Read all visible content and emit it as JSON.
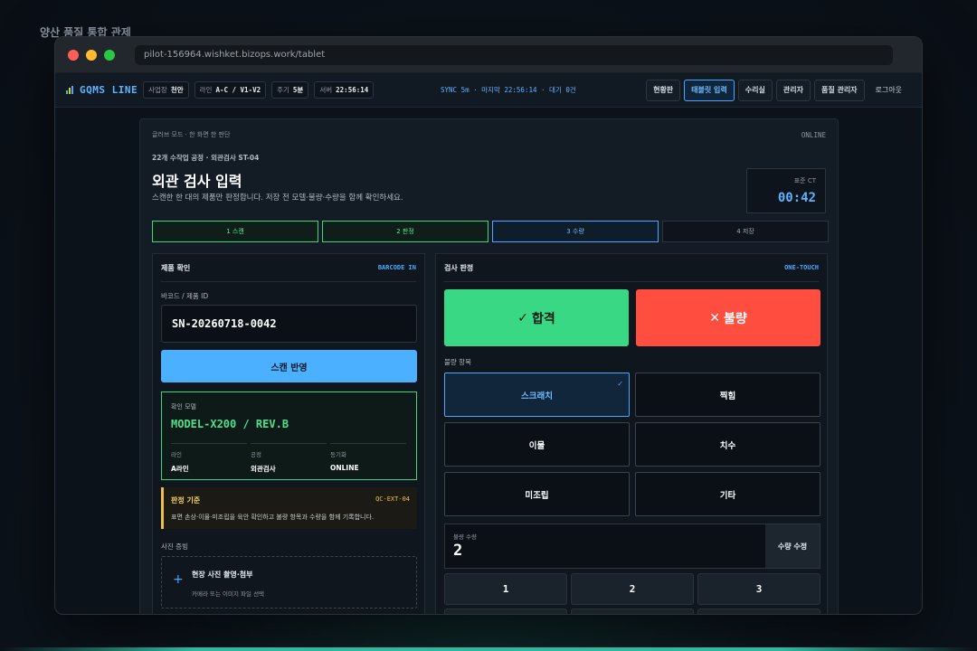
{
  "page_caption": "양산 품질 통합 관제",
  "browser": {
    "url": "pilot-156964.wishket.bizops.work/tablet"
  },
  "appbar": {
    "brand": "GQMS LINE",
    "chips": [
      {
        "label": "사업장",
        "value": "천안"
      },
      {
        "label": "라인",
        "value": "A-C / V1-V2"
      },
      {
        "label": "주기",
        "value": "5분"
      },
      {
        "label": "서버",
        "value": "22:56:14"
      }
    ],
    "sync": "SYNC 5m · 마지막 22:56:14 · 대기 0건",
    "nav": [
      {
        "label": "현황판",
        "state": "normal"
      },
      {
        "label": "태블릿 입력",
        "state": "active"
      },
      {
        "label": "수리실",
        "state": "normal"
      },
      {
        "label": "관리자",
        "state": "normal"
      },
      {
        "label": "품질 관리자",
        "state": "normal"
      },
      {
        "label": "로그아웃",
        "state": "plain"
      }
    ]
  },
  "panel": {
    "mode": "글러브 모드 · 한 화면 한 판단",
    "status": "ONLINE",
    "crumb": "22개 수작업 공정 · 외관검사 ST-04",
    "title": "외관 검사 입력",
    "subtitle": "스캔한 한 대의 제품만 판정합니다. 저장 전 모델·불량·수량을 함께 확인하세요.",
    "ct": {
      "label": "표준 CT",
      "value": "00:42"
    },
    "steps": [
      {
        "label": "1 스캔",
        "state": "done"
      },
      {
        "label": "2 판정",
        "state": "done"
      },
      {
        "label": "3 수량",
        "state": "current"
      },
      {
        "label": "4 저장",
        "state": "todo"
      }
    ]
  },
  "product": {
    "title": "제품 확인",
    "tag": "BARCODE IN",
    "barcode_label": "바코드 / 제품 ID",
    "barcode_value": "SN-20260718-0042",
    "scan_button": "스캔 반영",
    "model": {
      "caption": "확인 모델",
      "name": "MODEL-X200 / REV.B",
      "fields": [
        {
          "k": "라인",
          "v": "A라인"
        },
        {
          "k": "공정",
          "v": "외관검사"
        },
        {
          "k": "동기화",
          "v": "ONLINE"
        }
      ]
    },
    "criteria": {
      "title": "판정 기준",
      "code": "QC-EXT-04",
      "desc": "표면 손상·이물·미조립을 육안 확인하고 불량 항목과 수량을 함께 기록합니다."
    },
    "photo": {
      "section": "사진 증빙",
      "title": "현장 사진 촬영·첨부",
      "desc": "카메라 또는 이미지 파일 선택"
    }
  },
  "judgement": {
    "title": "검사 판정",
    "tag": "ONE-TOUCH",
    "pass": "합격",
    "fail": "불량",
    "defects_label": "불량 항목",
    "defects": [
      {
        "label": "스크래치",
        "selected": true
      },
      {
        "label": "찍힘",
        "selected": false
      },
      {
        "label": "이물",
        "selected": false
      },
      {
        "label": "치수",
        "selected": false
      },
      {
        "label": "미조립",
        "selected": false
      },
      {
        "label": "기타",
        "selected": false
      }
    ],
    "qty_label": "불량 수량",
    "qty_value": "2",
    "qty_edit": "수량 수정",
    "keypad": [
      "1",
      "2",
      "3",
      "",
      "",
      ""
    ]
  },
  "colors": {
    "accent": "#4ab0ff",
    "pass": "#38d884",
    "fail": "#ff4d3f",
    "warn": "#f0c040"
  }
}
